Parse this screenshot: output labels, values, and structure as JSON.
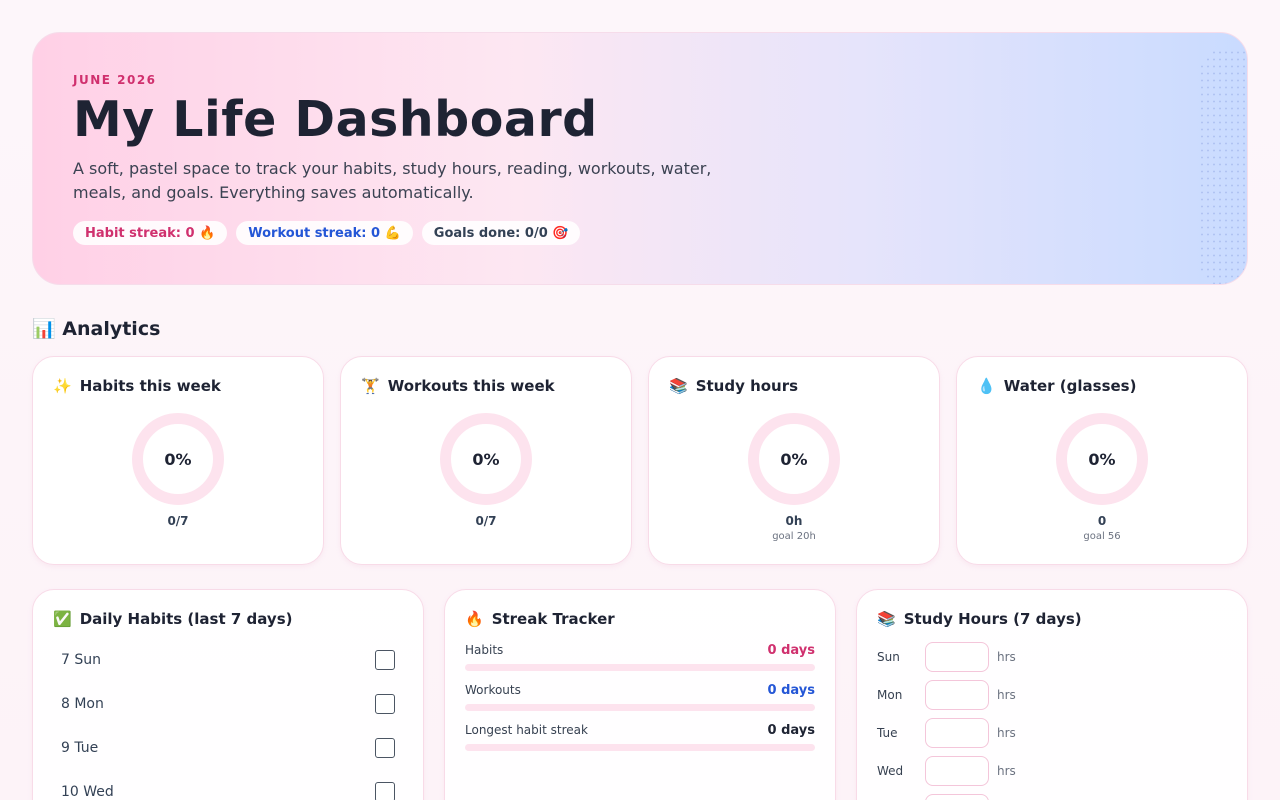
{
  "header": {
    "eyebrow": "JUNE 2026",
    "title": "My Life Dashboard",
    "subtitle": "A soft, pastel space to track your habits, study hours, reading, workouts, water, meals, and goals. Everything saves automatically.",
    "pills": [
      {
        "label": "Habit streak: 0 🔥",
        "color": "#d0306e"
      },
      {
        "label": "Workout streak: 0 💪",
        "color": "#2456d6"
      },
      {
        "label": "Goals done: 0/0 🎯",
        "color": "#334155"
      }
    ]
  },
  "analytics": {
    "title": "📊 Analytics",
    "cards": [
      {
        "icon": "✨",
        "title": "Habits this week",
        "percent": "0%",
        "value": "0/7",
        "goal": ""
      },
      {
        "icon": "🏋",
        "title": "Workouts this week",
        "percent": "0%",
        "value": "0/7",
        "goal": ""
      },
      {
        "icon": "📚",
        "title": "Study hours",
        "percent": "0%",
        "value": "0h",
        "goal": "goal 20h"
      },
      {
        "icon": "💧",
        "title": "Water (glasses)",
        "percent": "0%",
        "value": "0",
        "goal": "goal 56"
      }
    ]
  },
  "habits": {
    "icon": "✅",
    "title": "Daily Habits (last 7 days)",
    "days": [
      "7 Sun",
      "8 Mon",
      "9 Tue",
      "10 Wed"
    ]
  },
  "streaks": {
    "icon": "🔥",
    "title": "Streak Tracker",
    "rows": [
      {
        "label": "Habits",
        "value": "0 days",
        "color": "#d0306e"
      },
      {
        "label": "Workouts",
        "value": "0 days",
        "color": "#2456d6"
      },
      {
        "label": "Longest habit streak",
        "value": "0 days",
        "color": "#1e2333"
      }
    ]
  },
  "study": {
    "icon": "📚",
    "title": "Study Hours (7 days)",
    "unit": "hrs",
    "days": [
      "Sun",
      "Mon",
      "Tue",
      "Wed"
    ]
  },
  "colors": {
    "accent_pink": "#d0306e",
    "accent_blue": "#2456d6",
    "ring_track": "#fde3ee"
  }
}
